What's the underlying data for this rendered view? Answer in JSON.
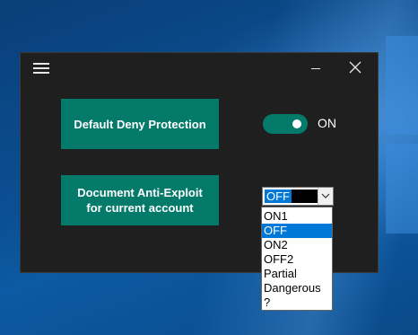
{
  "window": {
    "buttons": {
      "default_deny": "Default Deny Protection",
      "document_anti_exploit": "Document Anti-Exploit for current account"
    },
    "toggle": {
      "state_label": "ON",
      "checked": true,
      "accent_color": "#047a6b"
    },
    "combo": {
      "selected_value": "OFF",
      "options": [
        "ON1",
        "OFF",
        "ON2",
        "OFF2",
        "Partial",
        "Dangerous",
        "?"
      ],
      "highlight_color": "#0078d7"
    }
  },
  "icons": [
    "hamburger-menu-icon",
    "minimize-icon",
    "close-icon",
    "chevron-down-icon"
  ]
}
